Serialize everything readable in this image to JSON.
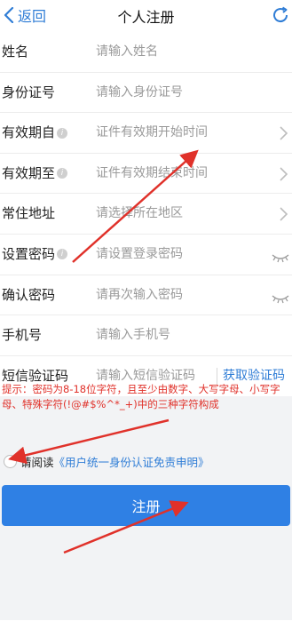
{
  "header": {
    "back_label": "返回",
    "title": "个人注册",
    "back_icon": "chevron-left-icon",
    "refresh_icon": "refresh-icon"
  },
  "form": {
    "rows": [
      {
        "label": "姓名",
        "placeholder": "请输入姓名"
      },
      {
        "label": "身份证号",
        "placeholder": "请输入身份证号"
      },
      {
        "label": "有效期自",
        "placeholder": "证件有效期开始时间"
      },
      {
        "label": "有效期至",
        "placeholder": "证件有效期结束时间"
      },
      {
        "label": "常住地址",
        "placeholder": "请选择所在地区"
      },
      {
        "label": "设置密码",
        "placeholder": "请设置登录密码"
      },
      {
        "label": "确认密码",
        "placeholder": "请再次输入密码"
      },
      {
        "label": "手机号",
        "placeholder": "请输入手机号"
      },
      {
        "label": "短信验证码",
        "placeholder": "请输入短信验证码",
        "action": "获取验证码"
      }
    ],
    "info_icon_text": "i"
  },
  "hint": "提示：密码为8-18位字符，且至少由数字、大写字母、小写字母、特殊字符(!@#$%^*_+)中的三种字符构成",
  "agreement": {
    "prefix": "请阅读",
    "link": "《用户统一身份认证免责申明》"
  },
  "submit_label": "注册",
  "colors": {
    "accent": "#2f80e4",
    "link": "#2f7dd6",
    "warning": "#e0312a",
    "annotation_arrow": "#e0312a"
  }
}
